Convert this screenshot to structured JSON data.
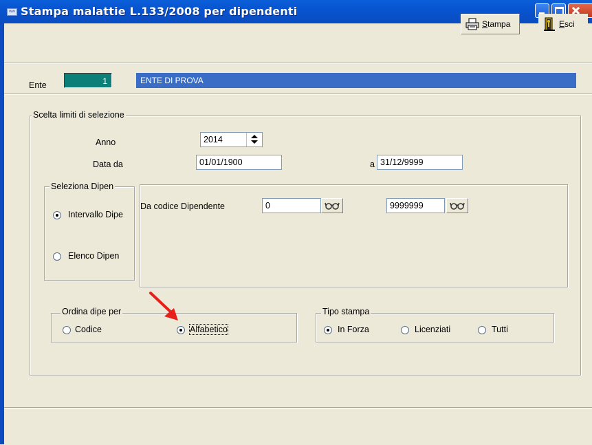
{
  "window": {
    "title": "Stampa malattie L.133/2008 per dipendenti",
    "app_icon_text": "ww"
  },
  "toolbar": {
    "stampa_label": "Stampa",
    "stampa_underline": "S",
    "stampa_rest": "tampa",
    "esci_underline": "E",
    "esci_rest": "sci"
  },
  "ente": {
    "label": "Ente",
    "code": "1",
    "name": "ENTE DI PROVA"
  },
  "selection": {
    "group_title": "Scelta limiti di selezione",
    "anno_label": "Anno",
    "anno_value": "2014",
    "data_da_label": "Data da",
    "data_da_value": "01/01/1900",
    "a_label": "a",
    "a_value": "31/12/9999"
  },
  "dipendenti": {
    "group_title": "Seleziona Dipen",
    "options": [
      "Intervallo Dipe",
      "Elenco Dipen"
    ],
    "selected": "Intervallo Dipe",
    "da_codice_label": "Da codice Dipendente",
    "da_codice_value": "0",
    "a_codice_value": "9999999",
    "lookup_glyph": "ᵒᵒ"
  },
  "ordina": {
    "group_title": "Ordina dipe per",
    "options": [
      "Codice",
      "Alfabetico"
    ],
    "selected": "Alfabetico"
  },
  "tipo_stampa": {
    "group_title": "Tipo stampa",
    "options": [
      "In Forza",
      "Licenziati",
      "Tutti"
    ],
    "selected": "In Forza"
  },
  "annotation": {
    "arrow_color": "#e8201a"
  },
  "colors": {
    "title_bar": "#0a5fd8",
    "ente_code_bg": "#0c8078",
    "ente_name_bg": "#3a6ec6",
    "window_bg": "#ece9d8"
  }
}
